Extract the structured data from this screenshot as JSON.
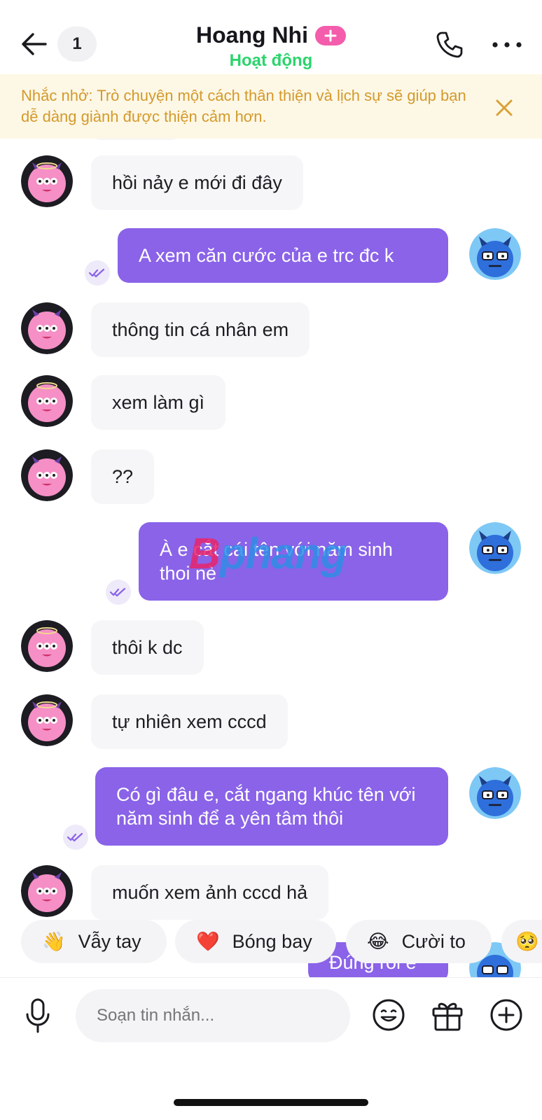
{
  "header": {
    "unread_count": "1",
    "title": "Hoang Nhi",
    "status": "Hoạt động"
  },
  "banner": {
    "text": "Nhắc nhở: Trò chuyện một cách thân thiện và lịch sự sẽ giúp bạn dễ dàng giành được thiện cảm hơn."
  },
  "messages": [
    {
      "from": "them",
      "text": "hồi nảy e mới đi đây"
    },
    {
      "from": "me",
      "text": "A xem căn cước của e trc đc k"
    },
    {
      "from": "them",
      "text": "thông tin cá nhân em"
    },
    {
      "from": "them",
      "text": "xem làm gì"
    },
    {
      "from": "them",
      "text": "??"
    },
    {
      "from": "me",
      "text": "À e cắt cái tên với năm sinh thoi nè"
    },
    {
      "from": "them",
      "text": "thôi k dc"
    },
    {
      "from": "them",
      "text": "tự nhiên xem cccd"
    },
    {
      "from": "me",
      "text": "Có gì đâu e, cắt ngang khúc tên với năm sinh để a yên tâm thôi"
    },
    {
      "from": "them",
      "text": "muốn xem ảnh cccd hả"
    },
    {
      "from": "me",
      "text": "Đúng rồi e"
    }
  ],
  "watermark": {
    "part1": "B",
    "part2": "phang"
  },
  "quick_replies": [
    {
      "emoji": "👋",
      "label": "Vẫy tay"
    },
    {
      "emoji": "❤️",
      "label": "Bóng bay"
    },
    {
      "emoji": "😂",
      "label": "Cười to"
    },
    {
      "emoji": "🥺",
      "label": ""
    }
  ],
  "composer": {
    "placeholder": "Soạn tin nhắn..."
  },
  "colors": {
    "accent_purple": "#8a63e8",
    "status_green": "#2bd46c",
    "banner_bg": "#fdf7e6",
    "banner_text": "#d39a2b",
    "plus_pink": "#f45dab"
  },
  "icons": {
    "back": "arrow-left-icon",
    "call": "phone-icon",
    "more": "more-horizontal-icon",
    "close": "close-icon",
    "mic": "microphone-icon",
    "emoji": "smiley-icon",
    "gift": "gift-icon",
    "add": "plus-circle-icon",
    "read": "double-check-icon"
  }
}
